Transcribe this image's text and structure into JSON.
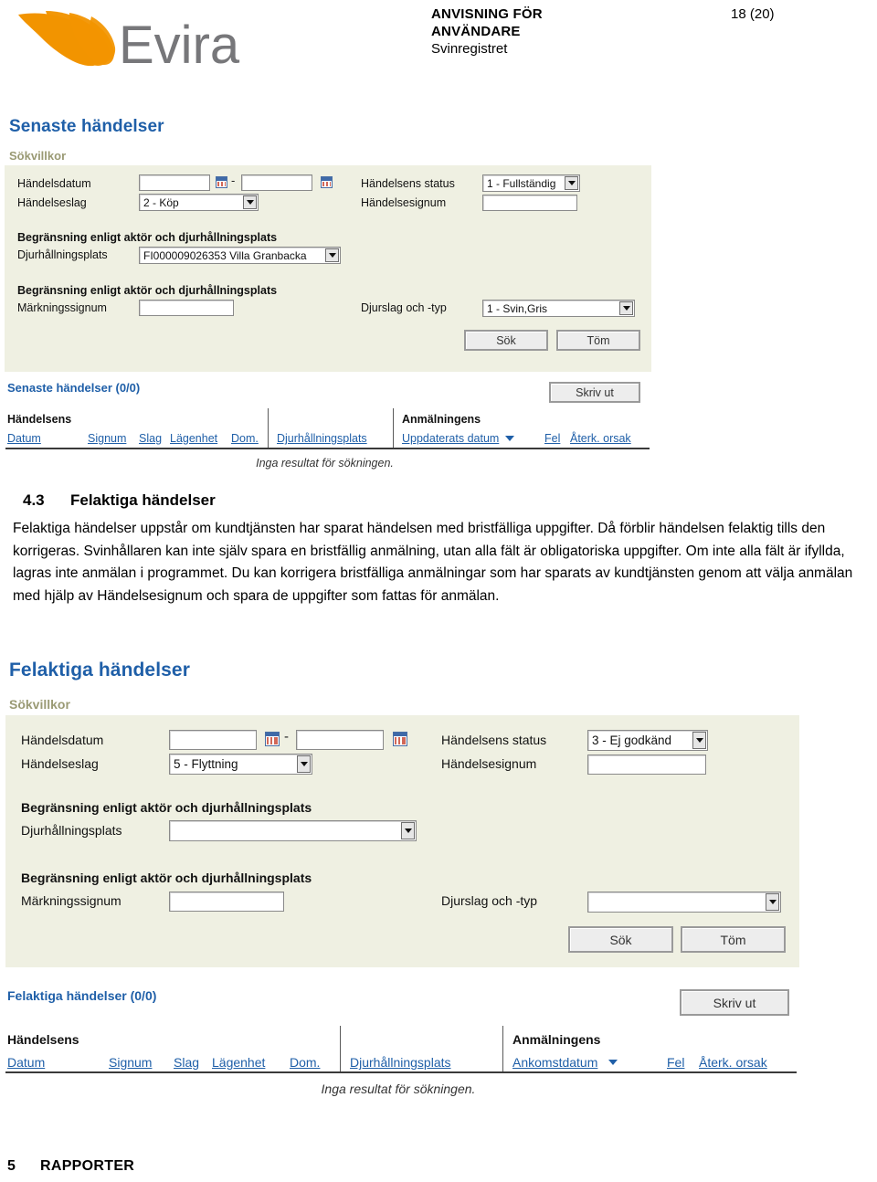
{
  "header": {
    "logo_alt": "Evira",
    "logo_text": "Evira",
    "doc_title_line1": "ANVISNING FÖR",
    "doc_title_line2": "ANVÄNDARE",
    "doc_subtitle": "Svinregistret",
    "page_number": "18 (20)"
  },
  "screenshot_1": {
    "title": "Senaste händelser",
    "search_legend": "Sökvillkor",
    "fields": {
      "date_label": "Händelsdatum",
      "date_from_value": "",
      "date_to_value": "",
      "date_separator": "-",
      "event_type_label": "Händelseslag",
      "event_type_value": "2 - Köp",
      "status_label": "Händelsens status",
      "status_value": "1 - Fullständig",
      "signum_label": "Händelsesignum",
      "signum_value": "",
      "limit_legend_1": "Begränsning enligt aktör och djurhållningsplats",
      "holding_label": "Djurhållningsplats",
      "holding_value": "FI000009026353 Villa Granbacka",
      "limit_legend_2": "Begränsning enligt aktör och djurhållningsplats",
      "marking_label": "Märkningssignum",
      "marking_value": "",
      "species_label": "Djurslag och -typ",
      "species_value": "1 - Svin,Gris"
    },
    "buttons": {
      "search": "Sök",
      "clear": "Töm",
      "print": "Skriv ut"
    },
    "results": {
      "title": "Senaste händelser (0/0)",
      "group_1": "Händelsens",
      "group_2": "Anmälningens",
      "columns": [
        "Datum",
        "Signum",
        "Slag",
        "Lägenhet",
        "Dom.",
        "Djurhållningsplats",
        "Uppdaterats datum",
        "Fel",
        "Återk. orsak"
      ],
      "empty_message": "Inga resultat för sökningen."
    }
  },
  "section": {
    "number": "4.3",
    "title": "Felaktiga händelser",
    "body": "Felaktiga händelser uppstår om kundtjänsten har sparat händelsen med bristfälliga uppgifter. Då förblir händelsen felaktig tills den korrigeras. Svinhållaren kan inte själv spara en bristfällig anmälning, utan alla fält är obligatoriska uppgifter. Om inte alla fält är ifyllda, lagras inte anmälan i programmet. Du kan korrigera bristfälliga anmälningar som har sparats av kundtjänsten genom att välja anmälan med hjälp av Händelsesignum och spara de uppgifter som fattas för anmälan."
  },
  "screenshot_2": {
    "title": "Felaktiga händelser",
    "search_legend": "Sökvillkor",
    "fields": {
      "date_label": "Händelsdatum",
      "date_from_value": "",
      "date_to_value": "",
      "date_separator": "-",
      "event_type_label": "Händelseslag",
      "event_type_value": "5 - Flyttning",
      "status_label": "Händelsens status",
      "status_value": "3 - Ej godkänd",
      "signum_label": "Händelsesignum",
      "signum_value": "",
      "limit_legend_1": "Begränsning enligt aktör och djurhållningsplats",
      "holding_label": "Djurhållningsplats",
      "holding_value": "",
      "limit_legend_2": "Begränsning enligt aktör och djurhållningsplats",
      "marking_label": "Märkningssignum",
      "marking_value": "",
      "species_label": "Djurslag och -typ",
      "species_value": ""
    },
    "buttons": {
      "search": "Sök",
      "clear": "Töm",
      "print": "Skriv ut"
    },
    "results": {
      "title": "Felaktiga händelser (0/0)",
      "group_1": "Händelsens",
      "group_2": "Anmälningens",
      "columns": [
        "Datum",
        "Signum",
        "Slag",
        "Lägenhet",
        "Dom.",
        "Djurhållningsplats",
        "Ankomstdatum",
        "Fel",
        "Återk. orsak"
      ],
      "empty_message": "Inga resultat för sökningen."
    }
  },
  "footer": {
    "number": "5",
    "title": "RAPPORTER"
  },
  "colors": {
    "panel_bg": "#eff0e2",
    "heading_blue": "#1f5fa8",
    "legend_olive": "#9a9a74",
    "logo_orange": "#f29400",
    "logo_gray": "#77777a"
  }
}
